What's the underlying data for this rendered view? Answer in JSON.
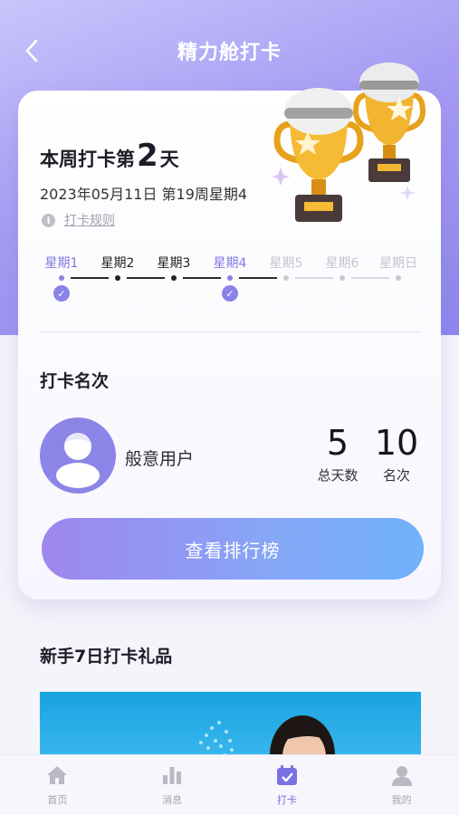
{
  "nav": {
    "title": "精力舱打卡",
    "back_icon": "chevron-left-icon"
  },
  "checkin": {
    "title_prefix": "本周打卡第",
    "title_count": "2",
    "title_suffix": "天",
    "date": "2023年05月11日  第19周星期4",
    "rules_label": "打卡规则",
    "days": [
      {
        "label": "星期1",
        "state": "checked"
      },
      {
        "label": "星期2",
        "state": "past"
      },
      {
        "label": "星期3",
        "state": "past"
      },
      {
        "label": "星期4",
        "state": "checked"
      },
      {
        "label": "星期5",
        "state": "future"
      },
      {
        "label": "星期6",
        "state": "future"
      },
      {
        "label": "星期日",
        "state": "future"
      }
    ]
  },
  "rank": {
    "title": "打卡名次",
    "user_name": "般意用户",
    "total_days": "5",
    "total_days_label": "总天数",
    "rank_value": "10",
    "rank_label": "名次",
    "button_label": "查看排行榜"
  },
  "gift": {
    "title": "新手7日打卡礼品"
  },
  "tabbar": {
    "items": [
      {
        "label": "首页",
        "icon": "home-icon"
      },
      {
        "label": "消息",
        "icon": "bar-chart-icon"
      },
      {
        "label": "打卡",
        "icon": "calendar-check-icon"
      },
      {
        "label": "我的",
        "icon": "person-icon"
      }
    ],
    "active_index": 2
  },
  "colors": {
    "accent": "#7a70e6",
    "hero": "#a79cf3",
    "checked": "#8a82e8"
  }
}
